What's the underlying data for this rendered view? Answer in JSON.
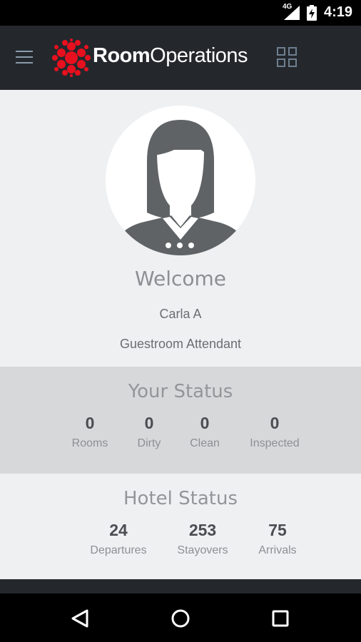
{
  "status_bar": {
    "network": "4G",
    "time": "4:19"
  },
  "app_bar": {
    "brand_bold": "Room",
    "brand_light": "Operations",
    "accent_color": "#e8101e"
  },
  "profile": {
    "welcome": "Welcome",
    "name": "Carla A",
    "role": "Guestroom Attendant"
  },
  "your_status": {
    "title": "Your Status",
    "stats": [
      {
        "value": "0",
        "label": "Rooms"
      },
      {
        "value": "0",
        "label": "Dirty"
      },
      {
        "value": "0",
        "label": "Clean"
      },
      {
        "value": "0",
        "label": "Inspected"
      }
    ]
  },
  "hotel_status": {
    "title": "Hotel Status",
    "stats": [
      {
        "value": "24",
        "label": "Departures"
      },
      {
        "value": "253",
        "label": "Stayovers"
      },
      {
        "value": "75",
        "label": "Arrivals"
      }
    ]
  }
}
